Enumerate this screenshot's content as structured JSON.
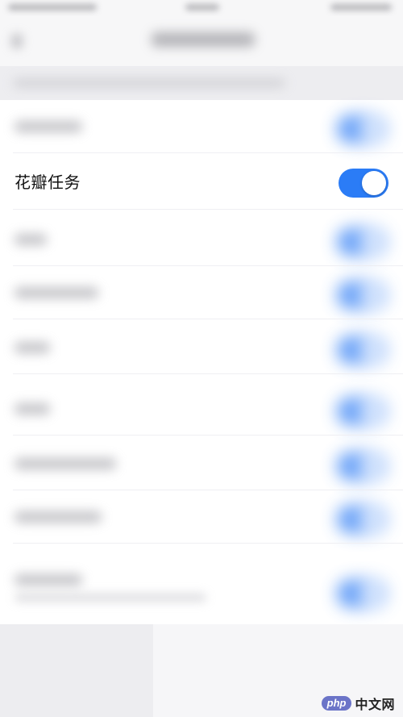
{
  "settings": {
    "visible_item": {
      "label": "花瓣任务",
      "toggle_on": true
    }
  },
  "watermark": {
    "badge": "php",
    "text": "中文网"
  },
  "colors": {
    "toggle_on": "#2b7cf6",
    "background": "#f2f2f4",
    "card": "#ffffff"
  },
  "icons": {
    "watermark": "php-cn-logo"
  }
}
